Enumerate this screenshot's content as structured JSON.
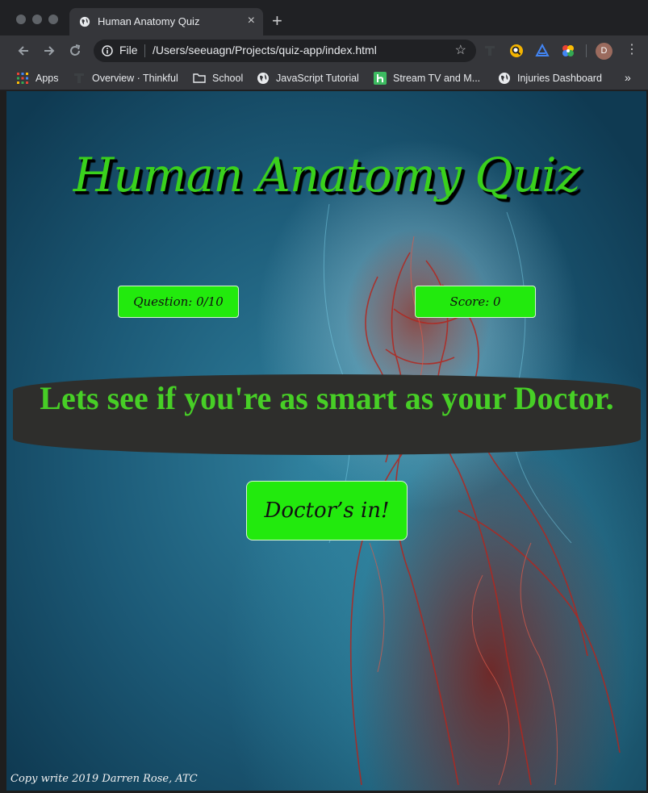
{
  "browser": {
    "tab": {
      "title": "Human Anatomy Quiz",
      "close_glyph": "×"
    },
    "new_tab_glyph": "+",
    "address_bar": {
      "scheme_label": "File",
      "url": "/Users/seeuagn/Projects/quiz-app/index.html",
      "star_glyph": "☆"
    },
    "profile_initial": "D",
    "menu_glyph": "⋮",
    "bookmarks": [
      {
        "label": "Apps",
        "icon": "apps-grid-icon"
      },
      {
        "label": "Overview · Thinkful",
        "icon": "thinkful-icon"
      },
      {
        "label": "School",
        "icon": "folder-icon"
      },
      {
        "label": "JavaScript Tutorial",
        "icon": "globe-icon"
      },
      {
        "label": "Stream TV and M...",
        "icon": "hulu-icon"
      },
      {
        "label": "Injuries Dashboard",
        "icon": "globe-icon"
      }
    ],
    "bookmarks_more_glyph": "»"
  },
  "page": {
    "title": "Human Anatomy Quiz",
    "question_counter": "Question: 0/10",
    "score": "Score: 0",
    "intro_message": "Lets see if you're as smart as your Doctor.",
    "start_button_label": "Doctor’s in!",
    "footer_text": "Copy write 2019 Darren Rose, ATC"
  },
  "colors": {
    "accent_green": "#22ea0d",
    "title_green": "#3ad11c",
    "banner_background": "#2e2e2c",
    "banner_text": "#47cf26"
  }
}
